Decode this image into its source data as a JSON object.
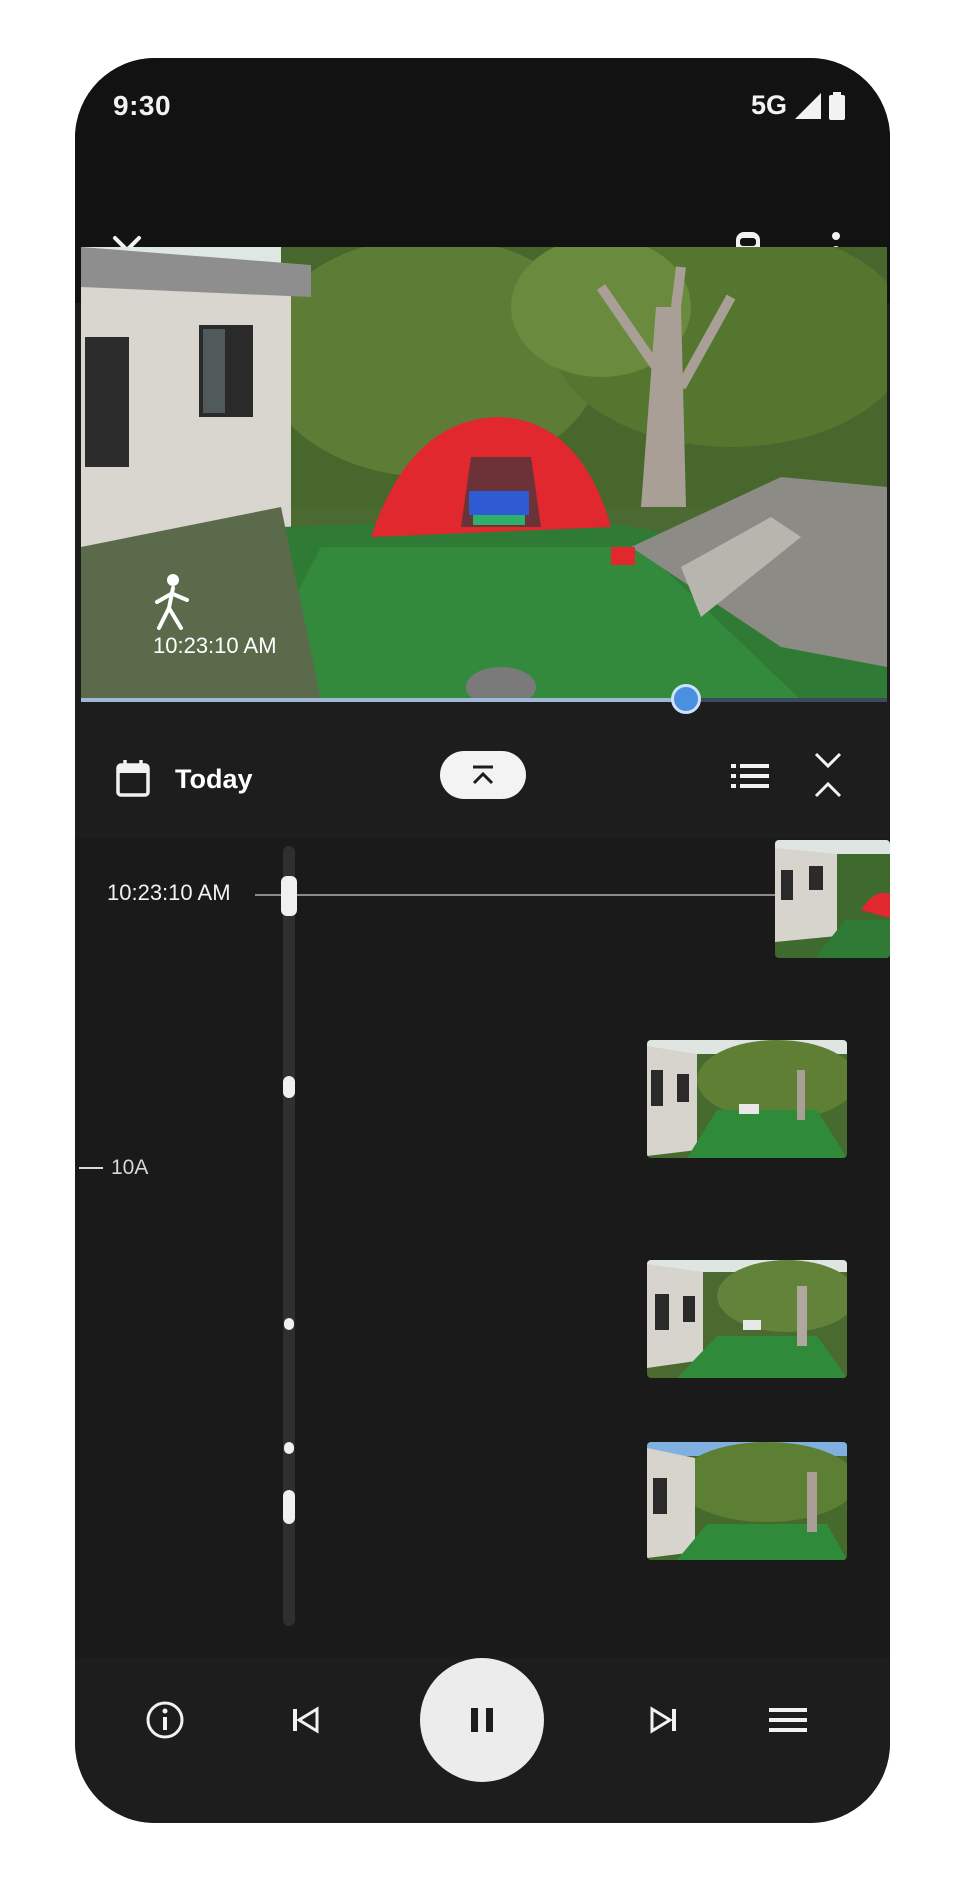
{
  "status_bar": {
    "time": "9:30",
    "network": "5G"
  },
  "video": {
    "event_time": "10:23:10 AM",
    "progress": 0.75
  },
  "controls": {
    "date_label": "Today"
  },
  "timeline": {
    "selected_time": "10:23:10 AM",
    "hour_label": "10A"
  },
  "icons": {
    "close": "close-icon",
    "camera": "camera-icon",
    "more": "more-vert-icon",
    "calendar": "calendar-icon",
    "collapse": "collapse-up-icon",
    "list": "list-icon",
    "expand": "expand-collapse-icon",
    "info": "info-icon",
    "prev": "skip-previous-icon",
    "pause": "pause-icon",
    "next": "skip-next-icon",
    "menu": "menu-icon"
  },
  "colors": {
    "background": "#1d1d1d",
    "accent": "#4a8fe0",
    "tent": "#e0282e"
  }
}
